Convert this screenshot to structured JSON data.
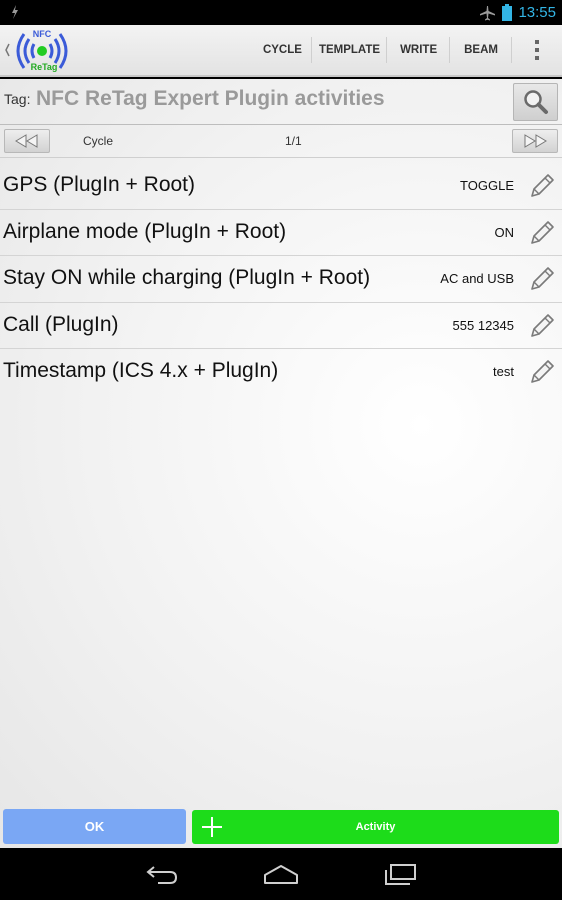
{
  "status_bar": {
    "time": "13:55",
    "icons": [
      "airplane-icon",
      "battery-icon",
      "notification-icon"
    ],
    "accent": "#33b5e5"
  },
  "action_bar": {
    "logo_text_top": "NFC",
    "logo_text_bottom": "ReTag",
    "actions": [
      "CYCLE",
      "TEMPLATE",
      "WRITE",
      "BEAM"
    ],
    "overflow_icon": "overflow-menu-icon"
  },
  "tag": {
    "label": "Tag:",
    "title": "NFC ReTag Expert Plugin activities",
    "search_icon": "search-icon"
  },
  "navigation": {
    "mode": "Cycle",
    "page": "1/1",
    "prev_icon": "rewind-icon",
    "next_icon": "fast-forward-icon"
  },
  "activities": [
    {
      "name": "GPS (PlugIn + Root)",
      "value": "TOGGLE"
    },
    {
      "name": "Airplane mode (PlugIn + Root)",
      "value": "ON"
    },
    {
      "name": "Stay ON while charging (PlugIn + Root)",
      "value": "AC and USB"
    },
    {
      "name": "Call (PlugIn)",
      "value": "555 12345"
    },
    {
      "name": "Timestamp (ICS 4.x + PlugIn)",
      "value": "test"
    }
  ],
  "buttons": {
    "ok": "OK",
    "activity": "Activity",
    "ok_color": "#7aa7f4",
    "activity_color": "#1ddc1a"
  },
  "system_nav": {
    "icons": [
      "back-icon",
      "home-icon",
      "recent-apps-icon"
    ]
  }
}
